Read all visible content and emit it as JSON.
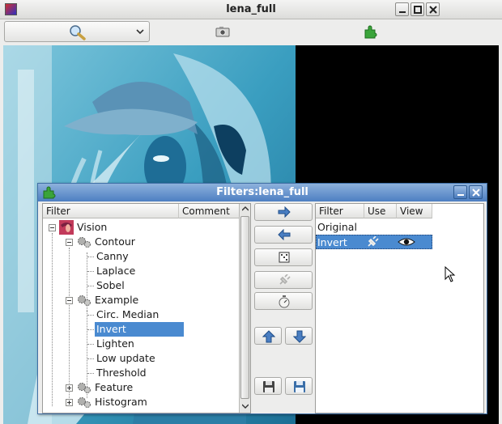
{
  "main_window": {
    "title": "lena_full",
    "toolbar": {
      "zoom_icon": "magnifier-icon",
      "camera_icon": "camera-icon",
      "plugin_icon": "puzzle-piece-icon"
    }
  },
  "filters_window": {
    "title": "Filters:lena_full",
    "tree": {
      "columns": [
        "Filter",
        "Comment"
      ],
      "root": {
        "label": "Vision",
        "icon": "vision-thumbnail-icon"
      },
      "groups": [
        {
          "label": "Contour",
          "expanded": true,
          "children": [
            "Canny",
            "Laplace",
            "Sobel"
          ]
        },
        {
          "label": "Example",
          "expanded": true,
          "children": [
            "Circ. Median",
            "Invert",
            "Lighten",
            "Low update",
            "Threshold"
          ]
        },
        {
          "label": "Feature",
          "expanded": false
        },
        {
          "label": "Histogram",
          "expanded": false
        }
      ],
      "selected": "Invert"
    },
    "buttons": [
      {
        "name": "add-filter-button",
        "icon": "arrow-right-icon"
      },
      {
        "name": "remove-filter-button",
        "icon": "arrow-left-icon"
      },
      {
        "name": "filter-options-button",
        "icon": "dice-icon"
      },
      {
        "name": "toggle-use-button",
        "icon": "plug-icon"
      },
      {
        "name": "filter-timer-button",
        "icon": "stopwatch-icon"
      },
      {
        "name": "move-up-button",
        "icon": "arrow-up-icon"
      },
      {
        "name": "move-down-button",
        "icon": "arrow-down-icon"
      },
      {
        "name": "save-button",
        "icon": "floppy-disk-icon"
      },
      {
        "name": "save-as-button",
        "icon": "floppy-disk-blue-icon"
      }
    ],
    "active_list": {
      "columns": [
        "Filter",
        "Use",
        "View"
      ],
      "rows": [
        {
          "label": "Original",
          "use": false,
          "view": false
        },
        {
          "label": "Invert",
          "use": true,
          "view": true
        }
      ],
      "selected": "Invert"
    }
  },
  "colors": {
    "dialog_title": "#4d7fc2",
    "selection": "#4a8ad0",
    "image_tint": "#3fb4d6"
  }
}
